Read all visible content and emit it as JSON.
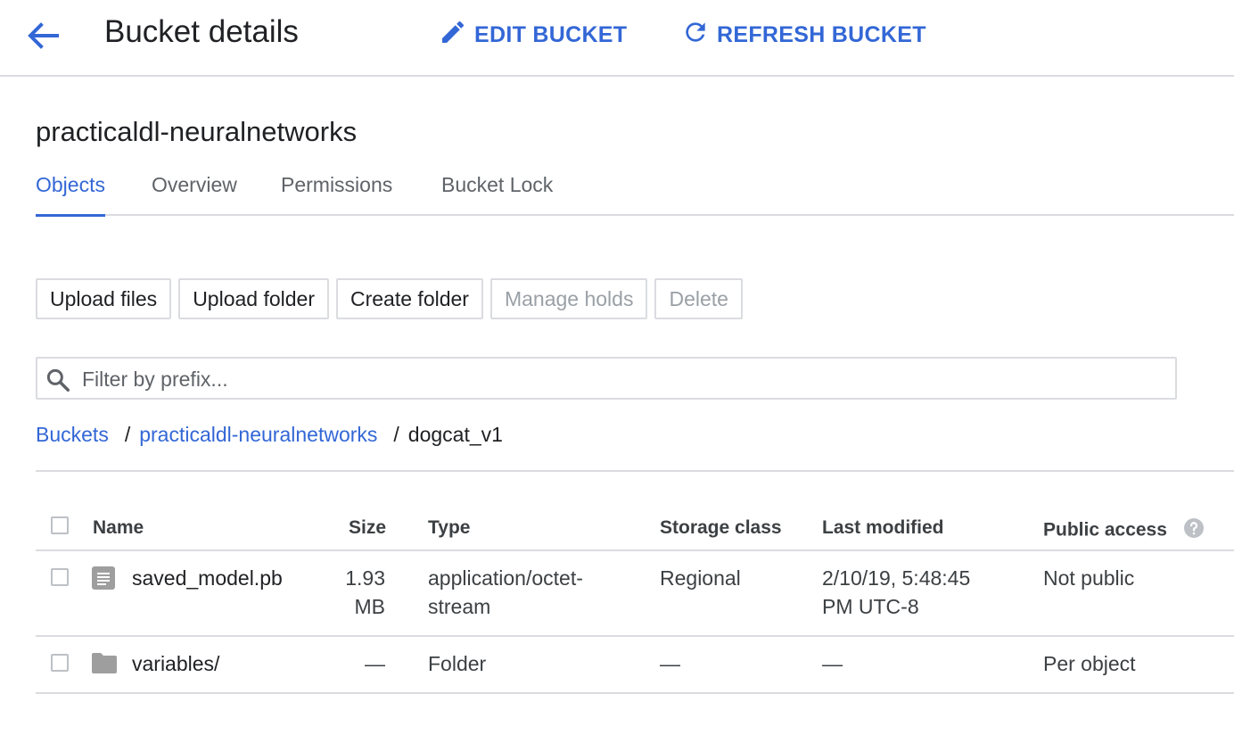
{
  "header": {
    "title": "Bucket details",
    "edit_label": "EDIT BUCKET",
    "refresh_label": "REFRESH BUCKET",
    "icons": [
      "back-arrow-icon",
      "pencil-icon",
      "refresh-icon"
    ],
    "accent_color": "#3367d6"
  },
  "bucket": {
    "name": "practicaldl-neuralnetworks"
  },
  "tabs": [
    {
      "label": "Objects",
      "active": true
    },
    {
      "label": "Overview"
    },
    {
      "label": "Permissions"
    },
    {
      "label": "Bucket Lock"
    }
  ],
  "buttons": {
    "upload_files": "Upload files",
    "upload_folder": "Upload folder",
    "create_folder": "Create folder",
    "manage_holds": "Manage holds",
    "delete": "Delete"
  },
  "filter": {
    "placeholder": "Filter by prefix..."
  },
  "breadcrumb": {
    "root": "Buckets",
    "sep": "/",
    "bucket": "practicaldl-neuralnetworks",
    "current": "dogcat_v1"
  },
  "table": {
    "columns": {
      "name": "Name",
      "size": "Size",
      "type": "Type",
      "storage": "Storage class",
      "modified": "Last modified",
      "access": "Public access"
    },
    "rows": [
      {
        "icon": "file-icon",
        "name": "saved_model.pb",
        "size_1": "1.93",
        "size_2": "MB",
        "type_1": "application/octet-",
        "type_2": "stream",
        "storage": "Regional",
        "modified_1": "2/10/19, 5:48:45",
        "modified_2": "PM UTC-8",
        "access": "Not public"
      },
      {
        "icon": "folder-icon",
        "name": "variables/",
        "size": "—",
        "type": "Folder",
        "storage": "—",
        "modified": "—",
        "access": "Per object"
      }
    ]
  }
}
